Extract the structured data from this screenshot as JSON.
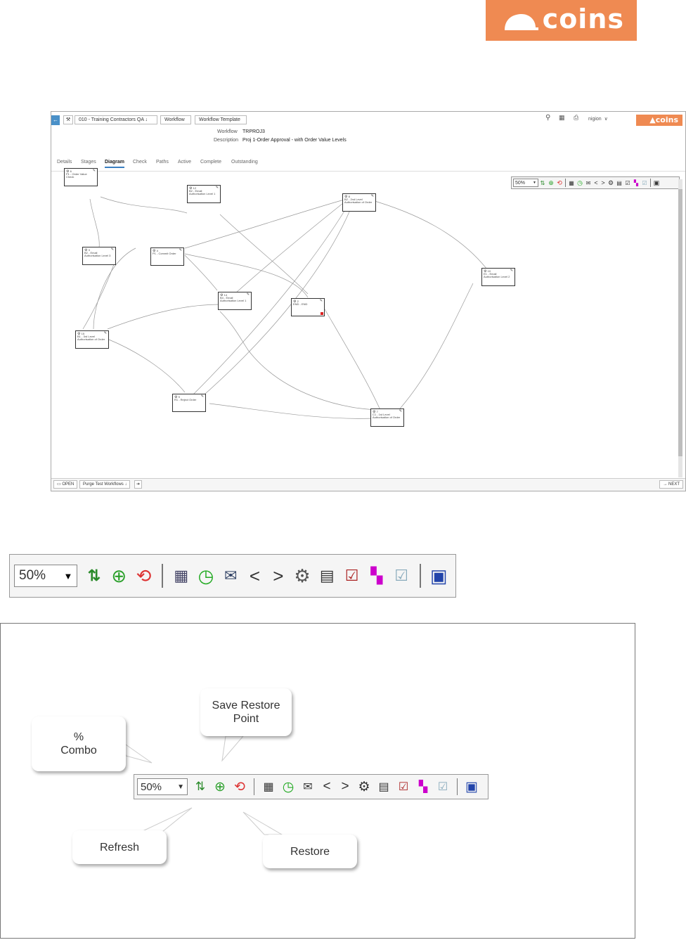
{
  "brand": {
    "logo_text": "coins",
    "mini_logo_text": "coins",
    "color": "#ef8a52"
  },
  "app": {
    "breadcrumbs": [
      "010 - Training Contractors QA",
      "Workflow",
      "Workflow Template"
    ],
    "user": "nigion",
    "workflow_label": "Workflow",
    "workflow_value": "TRPROJ3",
    "description_label": "Description",
    "description_value": "Proj 1-Order Approval - with Order Value Levels",
    "tabs": [
      "Details",
      "Stages",
      "Diagram",
      "Check",
      "Paths",
      "Active",
      "Complete",
      "Outstanding"
    ],
    "active_tab": "Diagram",
    "zoom": "50%",
    "nodes": [
      {
        "id": "P1",
        "title": "P1 - Order Value Check",
        "num": "6"
      },
      {
        "id": "B2",
        "title": "B2 - Email Authorisation Level 1",
        "num": "12"
      },
      {
        "id": "B2b",
        "title": "B2 - 2nd Level Authorisation of Order",
        "num": "8"
      },
      {
        "id": "B2c",
        "title": "B2 - Email Authorisation Level 3",
        "num": "3"
      },
      {
        "id": "P1b",
        "title": "P1 - Commit Order",
        "num": "4"
      },
      {
        "id": "E1",
        "title": "E1 - Email Authorisation Level 2",
        "num": "10"
      },
      {
        "id": "B4",
        "title": "B4 - Email Authorisation Level 1",
        "num": "14"
      },
      {
        "id": "END",
        "title": "END - END",
        "num": "2"
      },
      {
        "id": "B1",
        "title": "B1 - 3rd Level Authorisation of Order",
        "num": "15"
      },
      {
        "id": "R1",
        "title": "R1 - Reject Order",
        "num": "9"
      },
      {
        "id": "C1",
        "title": "C1 - 1st Level Authorisation of Order",
        "num": "7"
      }
    ],
    "bottom": {
      "open": "OPEN",
      "purge": "Purge Test Workflows",
      "next": "NEXT"
    }
  },
  "toolbar": {
    "zoom": "50%"
  },
  "callouts": {
    "combo": "% Combo",
    "save_restore": "Save Restore Point",
    "refresh": "Refresh",
    "restore": "Restore"
  }
}
